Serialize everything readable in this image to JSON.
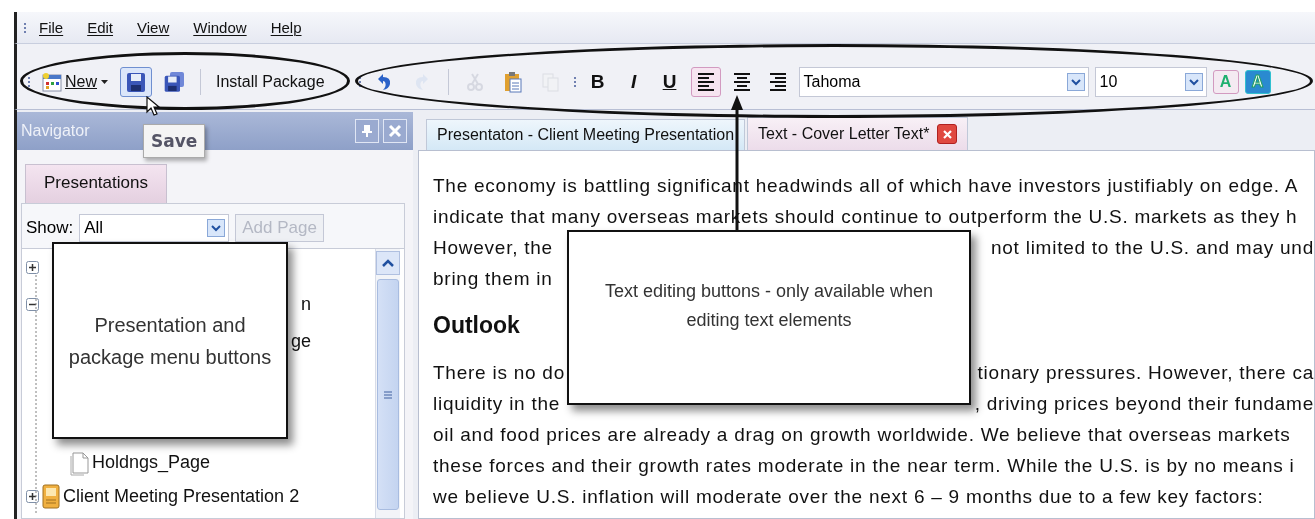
{
  "menu": [
    {
      "label": "File"
    },
    {
      "label": "Edit"
    },
    {
      "label": "View"
    },
    {
      "label": "Window"
    },
    {
      "label": "Help"
    }
  ],
  "toolbar": {
    "new_label": "New",
    "install_label": "Install Package",
    "edit_tools": [
      {
        "kind": "undo",
        "disabled": false
      },
      {
        "kind": "redo",
        "disabled": true
      },
      {
        "kind": "cut",
        "disabled": true
      },
      {
        "kind": "paste",
        "disabled": false
      },
      {
        "kind": "copy",
        "disabled": true
      }
    ],
    "styles": [
      {
        "kind": "bold",
        "label": "B"
      },
      {
        "kind": "italic",
        "label": "I"
      },
      {
        "kind": "underline",
        "label": "U"
      }
    ],
    "align": [
      {
        "kind": "left",
        "selected": true
      },
      {
        "kind": "center",
        "selected": false
      },
      {
        "kind": "right",
        "selected": false
      }
    ],
    "font": "Tahoma",
    "size": "10",
    "font_color": "A",
    "highlight": "A"
  },
  "tooltip": {
    "text": "Save"
  },
  "navigator": {
    "title": "Navigator",
    "tabs": [
      {
        "label": "Presentations",
        "selected": true
      }
    ],
    "show_label": "Show:",
    "show_value": "All",
    "add_page": {
      "label": "Add Page",
      "disabled": true
    },
    "tree": [
      {
        "kind": "node",
        "expanded": false
      },
      {
        "kind": "cut",
        "label": "n",
        "expanded": true,
        "children": [
          {
            "kind": "cut",
            "label": "ge"
          },
          {
            "kind": "page",
            "label": "Holdngs_Page"
          }
        ]
      },
      {
        "kind": "presentation",
        "label": "Client Meeting Presentation 2",
        "expanded": false
      }
    ]
  },
  "document": {
    "tabs": [
      {
        "label": "Presentaton - Client Meeting Presentation",
        "selected": false,
        "closable": false
      },
      {
        "label": "Text - Cover Letter Text*",
        "selected": true,
        "closable": true
      }
    ],
    "lines": [
      {
        "kind": "text",
        "segments": [
          "The economy is battling significant headwinds all of which have investors justifiably on edge. A"
        ]
      },
      {
        "kind": "text",
        "segments": [
          "indicate that many overseas markets should continue to outperform the U.S. markets as they h"
        ]
      },
      {
        "kind": "text",
        "segments": [
          "However, the",
          "not limited to the U.S. and may und"
        ]
      },
      {
        "kind": "text",
        "segments": [
          "bring them in"
        ]
      },
      {
        "kind": "heading",
        "segments": [
          "Outlook"
        ]
      },
      {
        "kind": "text",
        "segments": [
          "There is no do",
          "tionary pressures. However, there ca"
        ]
      },
      {
        "kind": "text",
        "segments": [
          "liquidity in the",
          ", driving prices beyond their fundame"
        ]
      },
      {
        "kind": "text",
        "segments": [
          "oil and food prices are already a drag on growth worldwide. We believe that overseas markets"
        ]
      },
      {
        "kind": "text",
        "segments": [
          "these forces and their growth rates moderate in the near term. While the U.S. is by no means i"
        ]
      },
      {
        "kind": "text",
        "segments": [
          "we believe U.S. inflation will moderate over the next 6 – 9 months due to a few key factors:"
        ]
      }
    ]
  },
  "callouts": [
    {
      "kind": "left",
      "text": "Presentation and package menu buttons"
    },
    {
      "kind": "arrow",
      "text": "Text editing buttons - only available when editing text elements"
    }
  ]
}
